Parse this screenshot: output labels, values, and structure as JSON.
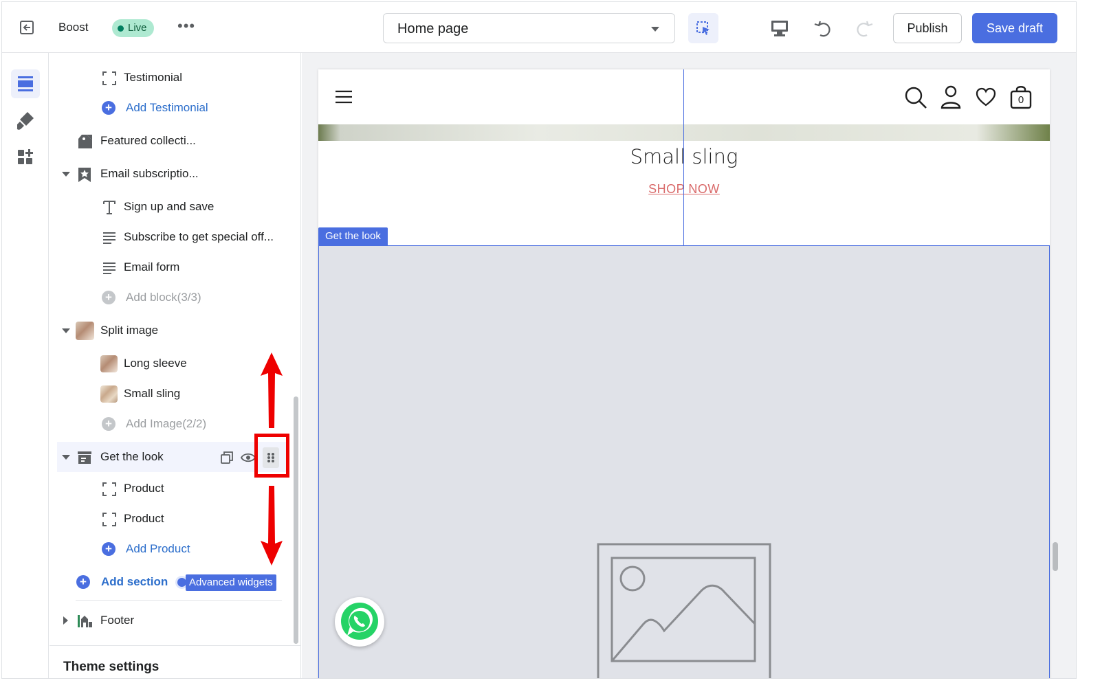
{
  "topbar": {
    "store_name": "Boost",
    "status_badge": "Live",
    "more_label": "•••",
    "page_selector": "Home page",
    "publish_label": "Publish",
    "save_label": "Save draft"
  },
  "sidebar": {
    "items": [
      {
        "label": "Testimonial"
      },
      {
        "label": "Add Testimonial"
      },
      {
        "label": "Featured collecti..."
      },
      {
        "label": "Email subscriptio..."
      },
      {
        "label": "Sign up and save"
      },
      {
        "label": "Subscribe to get special off..."
      },
      {
        "label": "Email form"
      },
      {
        "label": "Add block(3/3)"
      },
      {
        "label": "Split image"
      },
      {
        "label": "Long sleeve"
      },
      {
        "label": "Small sling"
      },
      {
        "label": "Add Image(2/2)"
      },
      {
        "label": "Get the look"
      },
      {
        "label": "Product"
      },
      {
        "label": "Product"
      },
      {
        "label": "Add Product"
      },
      {
        "label": "Add section"
      },
      {
        "label": "Footer"
      }
    ],
    "advanced_widgets": "Advanced widgets",
    "theme_settings": "Theme settings"
  },
  "preview": {
    "slide_title": "Small sling",
    "shop_now": "SHOP NOW",
    "section_tag": "Get the look",
    "cart_count": "0"
  },
  "colors": {
    "accent": "#4a6ee0",
    "live_badge": "#aee9d1",
    "annotation": "#ee0000",
    "shop_now": "#d96a6a"
  }
}
